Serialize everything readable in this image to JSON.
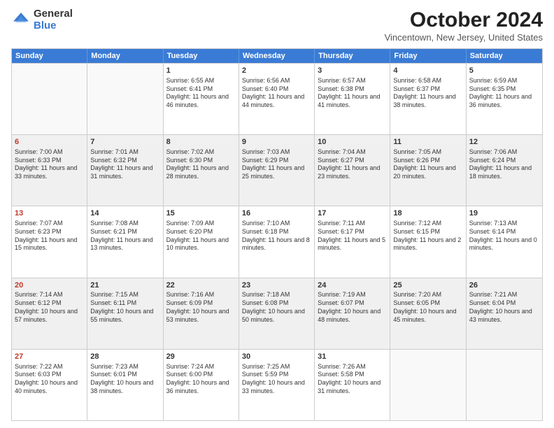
{
  "logo": {
    "general": "General",
    "blue": "Blue"
  },
  "title": {
    "month": "October 2024",
    "location": "Vincentown, New Jersey, United States"
  },
  "days_of_week": [
    "Sunday",
    "Monday",
    "Tuesday",
    "Wednesday",
    "Thursday",
    "Friday",
    "Saturday"
  ],
  "weeks": [
    [
      {
        "day": "",
        "empty": true,
        "shaded": false
      },
      {
        "day": "",
        "empty": true,
        "shaded": false
      },
      {
        "day": "1",
        "sunrise": "Sunrise: 6:55 AM",
        "sunset": "Sunset: 6:41 PM",
        "daylight": "Daylight: 11 hours and 46 minutes.",
        "shaded": false
      },
      {
        "day": "2",
        "sunrise": "Sunrise: 6:56 AM",
        "sunset": "Sunset: 6:40 PM",
        "daylight": "Daylight: 11 hours and 44 minutes.",
        "shaded": false
      },
      {
        "day": "3",
        "sunrise": "Sunrise: 6:57 AM",
        "sunset": "Sunset: 6:38 PM",
        "daylight": "Daylight: 11 hours and 41 minutes.",
        "shaded": false
      },
      {
        "day": "4",
        "sunrise": "Sunrise: 6:58 AM",
        "sunset": "Sunset: 6:37 PM",
        "daylight": "Daylight: 11 hours and 38 minutes.",
        "shaded": false
      },
      {
        "day": "5",
        "sunrise": "Sunrise: 6:59 AM",
        "sunset": "Sunset: 6:35 PM",
        "daylight": "Daylight: 11 hours and 36 minutes.",
        "shaded": false
      }
    ],
    [
      {
        "day": "6",
        "sunrise": "Sunrise: 7:00 AM",
        "sunset": "Sunset: 6:33 PM",
        "daylight": "Daylight: 11 hours and 33 minutes.",
        "shaded": true
      },
      {
        "day": "7",
        "sunrise": "Sunrise: 7:01 AM",
        "sunset": "Sunset: 6:32 PM",
        "daylight": "Daylight: 11 hours and 31 minutes.",
        "shaded": true
      },
      {
        "day": "8",
        "sunrise": "Sunrise: 7:02 AM",
        "sunset": "Sunset: 6:30 PM",
        "daylight": "Daylight: 11 hours and 28 minutes.",
        "shaded": true
      },
      {
        "day": "9",
        "sunrise": "Sunrise: 7:03 AM",
        "sunset": "Sunset: 6:29 PM",
        "daylight": "Daylight: 11 hours and 25 minutes.",
        "shaded": true
      },
      {
        "day": "10",
        "sunrise": "Sunrise: 7:04 AM",
        "sunset": "Sunset: 6:27 PM",
        "daylight": "Daylight: 11 hours and 23 minutes.",
        "shaded": true
      },
      {
        "day": "11",
        "sunrise": "Sunrise: 7:05 AM",
        "sunset": "Sunset: 6:26 PM",
        "daylight": "Daylight: 11 hours and 20 minutes.",
        "shaded": true
      },
      {
        "day": "12",
        "sunrise": "Sunrise: 7:06 AM",
        "sunset": "Sunset: 6:24 PM",
        "daylight": "Daylight: 11 hours and 18 minutes.",
        "shaded": true
      }
    ],
    [
      {
        "day": "13",
        "sunrise": "Sunrise: 7:07 AM",
        "sunset": "Sunset: 6:23 PM",
        "daylight": "Daylight: 11 hours and 15 minutes.",
        "shaded": false
      },
      {
        "day": "14",
        "sunrise": "Sunrise: 7:08 AM",
        "sunset": "Sunset: 6:21 PM",
        "daylight": "Daylight: 11 hours and 13 minutes.",
        "shaded": false
      },
      {
        "day": "15",
        "sunrise": "Sunrise: 7:09 AM",
        "sunset": "Sunset: 6:20 PM",
        "daylight": "Daylight: 11 hours and 10 minutes.",
        "shaded": false
      },
      {
        "day": "16",
        "sunrise": "Sunrise: 7:10 AM",
        "sunset": "Sunset: 6:18 PM",
        "daylight": "Daylight: 11 hours and 8 minutes.",
        "shaded": false
      },
      {
        "day": "17",
        "sunrise": "Sunrise: 7:11 AM",
        "sunset": "Sunset: 6:17 PM",
        "daylight": "Daylight: 11 hours and 5 minutes.",
        "shaded": false
      },
      {
        "day": "18",
        "sunrise": "Sunrise: 7:12 AM",
        "sunset": "Sunset: 6:15 PM",
        "daylight": "Daylight: 11 hours and 2 minutes.",
        "shaded": false
      },
      {
        "day": "19",
        "sunrise": "Sunrise: 7:13 AM",
        "sunset": "Sunset: 6:14 PM",
        "daylight": "Daylight: 11 hours and 0 minutes.",
        "shaded": false
      }
    ],
    [
      {
        "day": "20",
        "sunrise": "Sunrise: 7:14 AM",
        "sunset": "Sunset: 6:12 PM",
        "daylight": "Daylight: 10 hours and 57 minutes.",
        "shaded": true
      },
      {
        "day": "21",
        "sunrise": "Sunrise: 7:15 AM",
        "sunset": "Sunset: 6:11 PM",
        "daylight": "Daylight: 10 hours and 55 minutes.",
        "shaded": true
      },
      {
        "day": "22",
        "sunrise": "Sunrise: 7:16 AM",
        "sunset": "Sunset: 6:09 PM",
        "daylight": "Daylight: 10 hours and 53 minutes.",
        "shaded": true
      },
      {
        "day": "23",
        "sunrise": "Sunrise: 7:18 AM",
        "sunset": "Sunset: 6:08 PM",
        "daylight": "Daylight: 10 hours and 50 minutes.",
        "shaded": true
      },
      {
        "day": "24",
        "sunrise": "Sunrise: 7:19 AM",
        "sunset": "Sunset: 6:07 PM",
        "daylight": "Daylight: 10 hours and 48 minutes.",
        "shaded": true
      },
      {
        "day": "25",
        "sunrise": "Sunrise: 7:20 AM",
        "sunset": "Sunset: 6:05 PM",
        "daylight": "Daylight: 10 hours and 45 minutes.",
        "shaded": true
      },
      {
        "day": "26",
        "sunrise": "Sunrise: 7:21 AM",
        "sunset": "Sunset: 6:04 PM",
        "daylight": "Daylight: 10 hours and 43 minutes.",
        "shaded": true
      }
    ],
    [
      {
        "day": "27",
        "sunrise": "Sunrise: 7:22 AM",
        "sunset": "Sunset: 6:03 PM",
        "daylight": "Daylight: 10 hours and 40 minutes.",
        "shaded": false
      },
      {
        "day": "28",
        "sunrise": "Sunrise: 7:23 AM",
        "sunset": "Sunset: 6:01 PM",
        "daylight": "Daylight: 10 hours and 38 minutes.",
        "shaded": false
      },
      {
        "day": "29",
        "sunrise": "Sunrise: 7:24 AM",
        "sunset": "Sunset: 6:00 PM",
        "daylight": "Daylight: 10 hours and 36 minutes.",
        "shaded": false
      },
      {
        "day": "30",
        "sunrise": "Sunrise: 7:25 AM",
        "sunset": "Sunset: 5:59 PM",
        "daylight": "Daylight: 10 hours and 33 minutes.",
        "shaded": false
      },
      {
        "day": "31",
        "sunrise": "Sunrise: 7:26 AM",
        "sunset": "Sunset: 5:58 PM",
        "daylight": "Daylight: 10 hours and 31 minutes.",
        "shaded": false
      },
      {
        "day": "",
        "empty": true,
        "shaded": false
      },
      {
        "day": "",
        "empty": true,
        "shaded": false
      }
    ]
  ]
}
